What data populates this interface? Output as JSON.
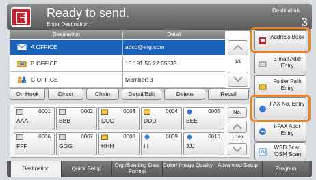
{
  "header": {
    "title": "Ready to send.",
    "subtitle": "Enter Destination.",
    "destination_label": "Destination",
    "destination_count": "3"
  },
  "list": {
    "col_destination": "Destination",
    "col_detail": "Detail",
    "rows": [
      {
        "name": "A OFFICE",
        "detail": "abcd@efg.com",
        "icon": "email-icon"
      },
      {
        "name": "B OFFICE",
        "detail": "10.181.56.22:65535",
        "icon": "folder-icon"
      },
      {
        "name": "C OFFICE",
        "detail": "Member:   3",
        "icon": "group-icon"
      }
    ],
    "page": "1/1"
  },
  "actions": {
    "on_hook": "On Hook",
    "direct": "Direct",
    "chain": "Chain",
    "detail_edit": "Detail/Edit",
    "delete": "Delete",
    "recall": "Recall"
  },
  "keys": [
    {
      "num": "0001",
      "name": "AAA"
    },
    {
      "num": "0002",
      "name": "BBB"
    },
    {
      "num": "0003",
      "name": "CCC"
    },
    {
      "num": "0004",
      "name": "DDD"
    },
    {
      "num": "0005",
      "name": "EEE"
    },
    {
      "num": "0006",
      "name": "FFF"
    },
    {
      "num": "0007",
      "name": "GGG"
    },
    {
      "num": "0008",
      "name": "HHH"
    },
    {
      "num": "0009",
      "name": "III"
    },
    {
      "num": "0010",
      "name": "JJJ"
    }
  ],
  "keys_side": {
    "no": "No.",
    "page": "1/100"
  },
  "right": {
    "address_book": "Address Book",
    "email_entry": "E-mail Addr Entry",
    "folder_entry": "Folder Path Entry",
    "fax_entry": "FAX No. Entry",
    "ifax_entry": "i-FAX Addr Entry",
    "wsd_scan": "WSD Scan /DSM Scan"
  },
  "tabs": [
    "Destination",
    "Quick Setup",
    "Org./Sending Data Format",
    "Color/ Image Quality",
    "Advanced Setup",
    "Program"
  ],
  "colors": {
    "selected_row": "#1a61b8",
    "highlight": "#e9862a",
    "home": "#c8202a"
  }
}
